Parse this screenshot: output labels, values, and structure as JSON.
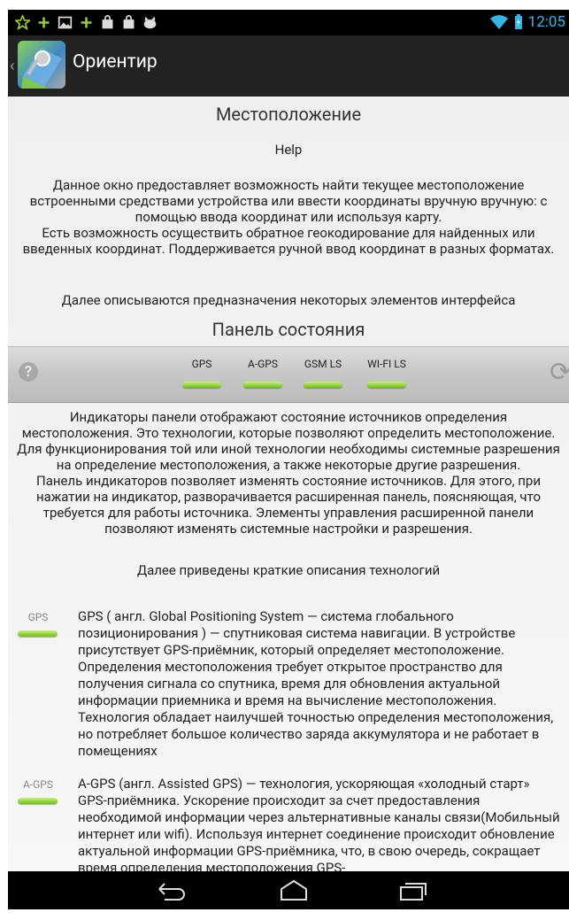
{
  "status_bar": {
    "time": "12:05"
  },
  "action_bar": {
    "title": "Ориентир"
  },
  "content": {
    "heading": "Местоположение",
    "help_title": "Help",
    "intro": "Данное окно предоставляет возможность найти текущее местоположение встроенными средствами устройства или ввести координаты вручную вручную: с помощью ввода координат или используя карту.\nЕсть возможность осуществить обратное геокодирование для найденных или введенных координат. Поддерживается ручной ввод координат в разных форматах.",
    "elements_desc": "Далее описываются предназначения некоторых элементов интерфейса",
    "panel_heading": "Панель состояния",
    "indicators": [
      {
        "label": "GPS"
      },
      {
        "label": "A-GPS"
      },
      {
        "label": "GSM LS"
      },
      {
        "label": "WI-FI LS"
      }
    ],
    "panel_desc": "Индикаторы панели отображают состояние источников определения местоположения. Это технологии, которые позволяют определить местоположение. Для функционирования той или иной технологии необходимы системные разрешения на определение местоположения, а также некоторые другие разрешения.\nПанель индикаторов позволяет изменять состояние источников. Для этого, при нажатии на индикатор, разворачивается расширенная панель, поясняющая, что требуется для работы источника. Элементы управления расширенной панели позволяют изменять системные настройки и разрешения.",
    "tech_intro": "Далее приведены краткие описания технологий",
    "technologies": [
      {
        "label": "GPS",
        "text": "GPS ( англ. Global Positioning System — система глобального позиционирования ) — спутниковая система навигации. В устройстве присутствует GPS-приёмник, который определяет местоположение. Определения местоположения требует открытое пространство для получения сигнала со спутника, время для обновления актуальной информации приемника и время на вычисление местоположения. Технология обладает наилучшей точностью определения местоположения, но потребляет большое количество заряда аккумулятора и не работает в помещениях"
      },
      {
        "label": "A-GPS",
        "text": "A-GPS (англ. Assisted GPS) — технология, ускоряющая «холодный старт» GPS-приёмника. Ускорение происходит за счет предоставления необходимой информации через альтернативные каналы связи(Мобильный интернет или wifi). Используя интернет соединение происходит обновление актуальной информации GPS-приёмника, что, в свою очередь, сокращает время определения местоположения GPS-"
      }
    ]
  }
}
